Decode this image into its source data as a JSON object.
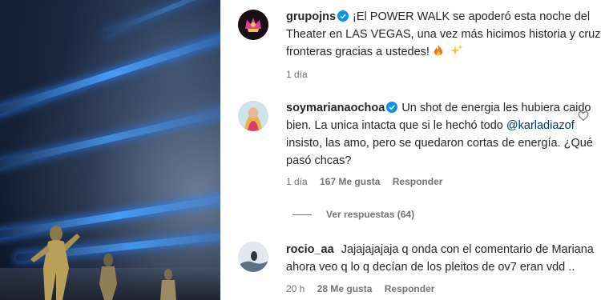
{
  "post": {
    "username": "grupojns",
    "verified": true,
    "caption_line1": "¡El POWER WALK se apoderó esta noche del",
    "caption_line2": "Theater en LAS VEGAS, una vez más hicimos historia y cruzamos",
    "caption_line3": "fronteras gracias a ustedes!",
    "caption_emojis": [
      "fire-emoji",
      "sparkles-emoji"
    ],
    "time": "1 día"
  },
  "comments": [
    {
      "username": "soymarianaochoa",
      "verified": true,
      "line1": "Un shot de energia les hubiera caido",
      "line2_prefix": "bien. La unica intacta que si le hechó todo",
      "mention": "@karladiazof",
      "line3": "insisto, las amo, pero se quedaron cortas de energía. ¿Qué",
      "line4": "pasó chcas?",
      "time": "1 día",
      "likes": "167 Me gusta",
      "reply": "Responder",
      "view_replies": "Ver respuestas (64)"
    },
    {
      "username": "rocio_aa",
      "verified": false,
      "line1": "Jajajajajaja q onda con el comentario de Mariana",
      "line2": "ahora veo q lo q decían de los pleitos de ov7 eran vdd ..",
      "time": "20 h",
      "likes": "28 Me gusta",
      "reply": "Responder"
    }
  ],
  "colors": {
    "text": "#262626",
    "meta": "#737373",
    "mention": "#00376b",
    "verified": "#0095f6",
    "beam": "#3c8cff"
  }
}
